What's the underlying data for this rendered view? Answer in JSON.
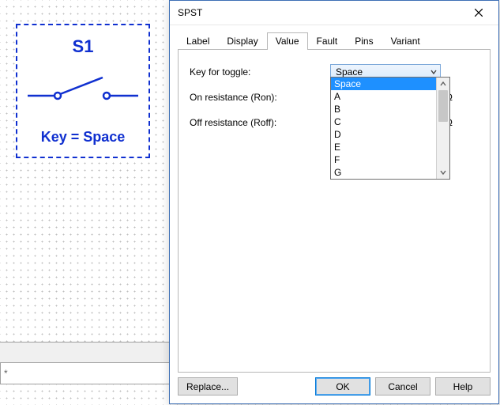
{
  "schematic": {
    "refdes": "S1",
    "key_line": "Key = Space"
  },
  "status_bar_text": "*",
  "dialog": {
    "title": "SPST",
    "tabs": {
      "label": "Label",
      "display": "Display",
      "value": "Value",
      "fault": "Fault",
      "pins": "Pins",
      "variant": "Variant"
    },
    "value_tab": {
      "key_for_toggle_label": "Key for toggle:",
      "key_for_toggle_value": "Space",
      "key_options": [
        "Space",
        "A",
        "B",
        "C",
        "D",
        "E",
        "F",
        "G"
      ],
      "on_resistance_label": "On resistance (Ron):",
      "on_resistance_unit": "Ω",
      "off_resistance_label": "Off resistance (Roff):",
      "off_resistance_unit": "Ω"
    },
    "buttons": {
      "replace": "Replace...",
      "ok": "OK",
      "cancel": "Cancel",
      "help": "Help"
    }
  }
}
